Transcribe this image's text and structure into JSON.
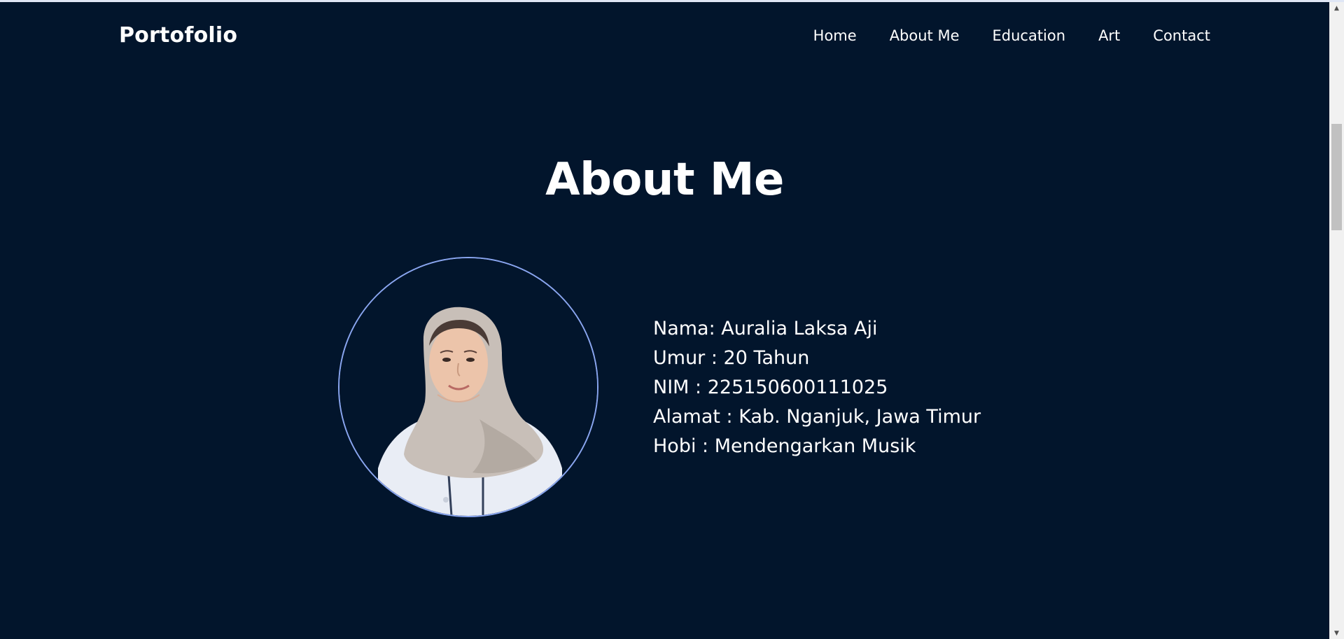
{
  "navbar": {
    "brand": "Portofolio",
    "links": [
      {
        "label": "Home"
      },
      {
        "label": "About Me"
      },
      {
        "label": "Education"
      },
      {
        "label": "Art"
      },
      {
        "label": "Contact"
      }
    ]
  },
  "about": {
    "title": "About Me",
    "photo_icon": "profile-photo",
    "lines": [
      "Nama: Auralia Laksa Aji",
      "Umur : 20 Tahun",
      "NIM : 225150600111025",
      "Alamat : Kab. Nganjuk, Jawa Timur",
      "Hobi : Mendengarkan Musik"
    ]
  },
  "scrollbar": {
    "up_icon": "scroll-up-arrow",
    "down_icon": "scroll-down-arrow"
  },
  "colors": {
    "background": "#02152c",
    "text": "#ffffff",
    "avatar_border": "#8aa6f0"
  }
}
